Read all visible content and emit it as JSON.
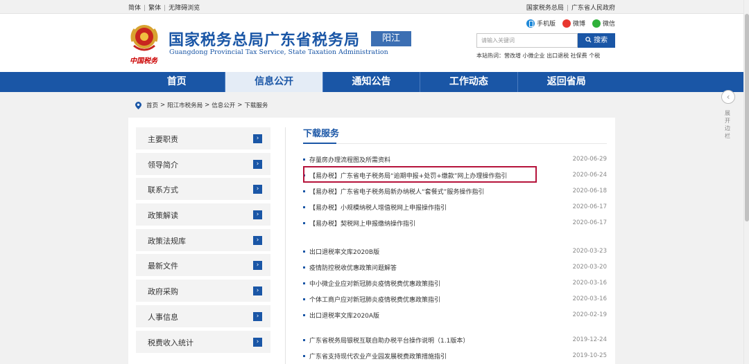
{
  "topbar": {
    "left_links": [
      "简体",
      "繁体",
      "无障碍浏览"
    ],
    "right_links": [
      "国家税务总局",
      "广东省人民政府"
    ]
  },
  "header": {
    "logo_text": "中国税务",
    "title_cn": "国家税务总局广东省税务局",
    "title_en": "Guangdong Provincial Tax Service, State Taxation Administration",
    "region": "阳江",
    "social": [
      "手机版",
      "微博",
      "微信"
    ],
    "search_placeholder": "请输入关键词",
    "search_button": "搜索",
    "hot_label": "本站热词：",
    "hot_words": [
      "营改增",
      "小微企业",
      "出口退税",
      "社保费",
      "个税"
    ]
  },
  "nav": {
    "items": [
      "首页",
      "信息公开",
      "通知公告",
      "工作动态",
      "返回省局"
    ],
    "active_index": 1
  },
  "side_toggle": {
    "text": "展开边栏"
  },
  "breadcrumb": [
    "首页",
    "阳江市税务局",
    "信息公开",
    "下载服务"
  ],
  "sidebar": {
    "items": [
      "主要职责",
      "领导简介",
      "联系方式",
      "政策解读",
      "政策法规库",
      "最新文件",
      "政府采购",
      "人事信息",
      "税费收入统计"
    ]
  },
  "main": {
    "title": "下载服务",
    "groups": [
      [
        {
          "title": "存量房办理流程图及所需资料",
          "date": "2020-06-29"
        },
        {
          "title": "【易办税】广东省电子税务局“逾期申报+处罚+缴款”网上办理操作指引",
          "date": "2020-06-24"
        },
        {
          "title": "【易办税】广东省电子税务局新办纳税人“套餐式”服务操作指引",
          "date": "2020-06-18"
        },
        {
          "title": "【易办税】小规模纳税人增值税网上申报操作指引",
          "date": "2020-06-17"
        },
        {
          "title": "【易办税】契税网上申报缴纳操作指引",
          "date": "2020-06-17"
        }
      ],
      [
        {
          "title": "出口退税率文库2020B版",
          "date": "2020-03-23"
        },
        {
          "title": "疫情防控税收优惠政策问题解答",
          "date": "2020-03-20"
        },
        {
          "title": "中小微企业应对新冠肺炎疫情税费优惠政策指引",
          "date": "2020-03-16"
        },
        {
          "title": "个体工商户应对新冠肺炎疫情税费优惠政策指引",
          "date": "2020-03-16"
        },
        {
          "title": "出口退税率文库2020A版",
          "date": "2020-02-19"
        }
      ],
      [
        {
          "title": "广东省税务局银税互联自助办税平台操作说明（1.1版本）",
          "date": "2019-12-24"
        },
        {
          "title": "广东省支持现代农业产业园发展税费政策措施指引",
          "date": "2019-10-25"
        }
      ]
    ]
  },
  "colors": {
    "brand": "#1a56a6",
    "highlight": "#b5123a"
  }
}
